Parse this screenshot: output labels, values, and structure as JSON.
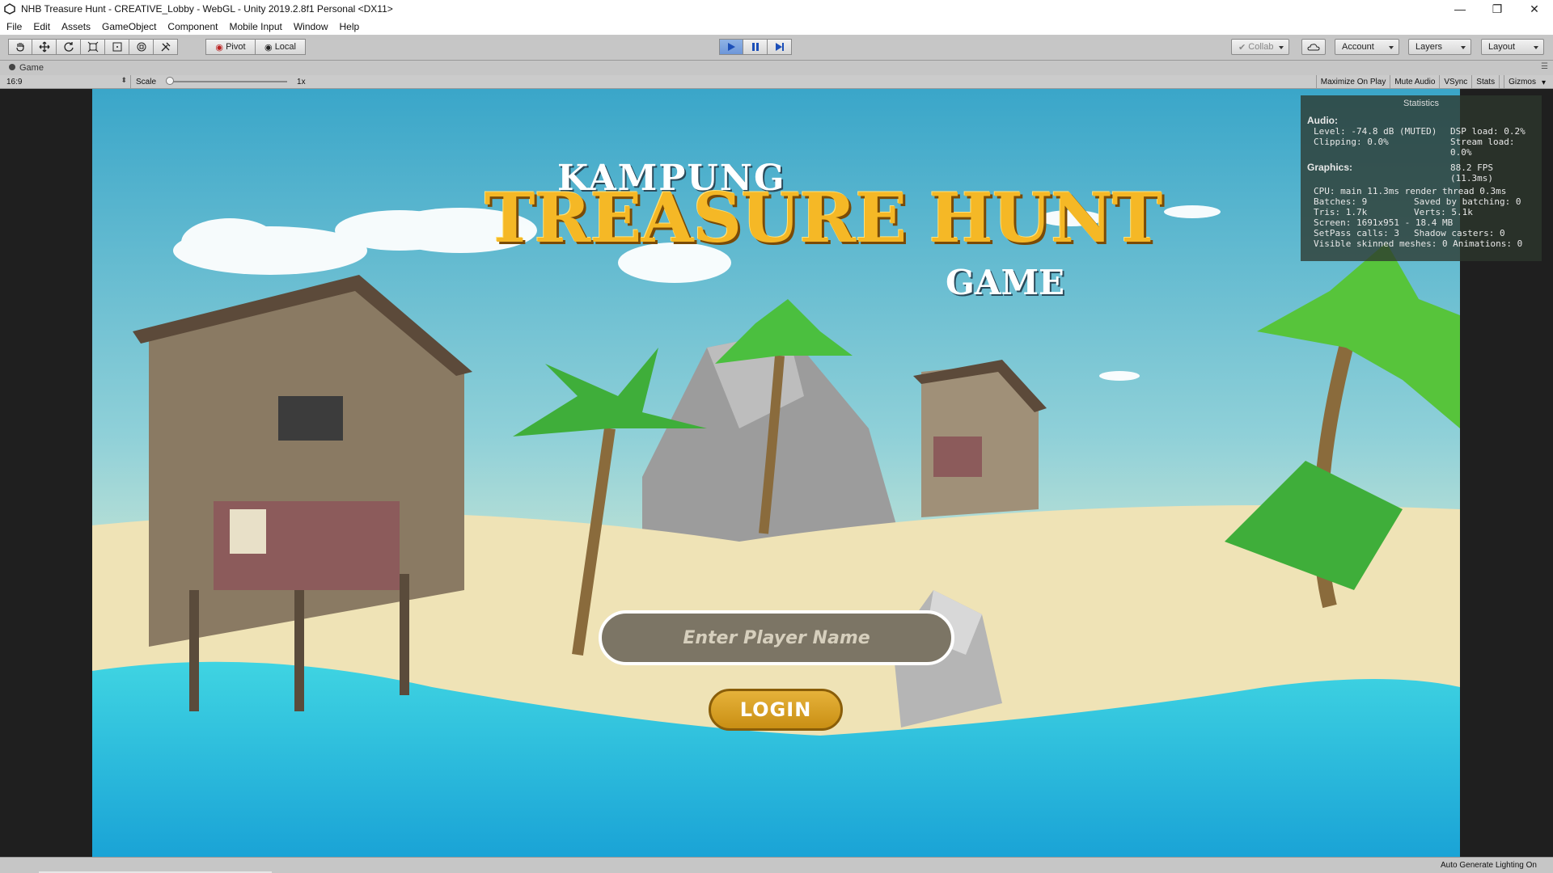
{
  "window": {
    "title": "NHB Treasure Hunt - CREATIVE_Lobby - WebGL - Unity 2019.2.8f1 Personal <DX11>",
    "controls": {
      "minimize": "—",
      "restore": "❐",
      "close": "✕"
    }
  },
  "menu": [
    "File",
    "Edit",
    "Assets",
    "GameObject",
    "Component",
    "Mobile Input",
    "Window",
    "Help"
  ],
  "toolbar": {
    "tools": [
      "hand-tool",
      "move-tool",
      "rotate-tool",
      "scale-tool",
      "rect-tool",
      "transform-tool",
      "custom-tool"
    ],
    "pivot_label": "Pivot",
    "local_label": "Local",
    "play_states": [
      "play",
      "pause",
      "step"
    ],
    "collab_label": "Collab",
    "account_label": "Account",
    "layers_label": "Layers",
    "layout_label": "Layout"
  },
  "game_tab": {
    "label": "Game"
  },
  "game_bar": {
    "aspect": "16:9",
    "scale_label": "Scale",
    "scale_value": "1x",
    "buttons": [
      "Maximize On Play",
      "Mute Audio",
      "VSync",
      "Stats",
      "Gizmos"
    ]
  },
  "scene": {
    "logo_top": "KAMPUNG",
    "logo_main": "TREASURE HUNT",
    "logo_bottom": "GAME",
    "input_placeholder": "Enter Player Name",
    "login_label": "LOGIN"
  },
  "stats": {
    "title": "Statistics",
    "audio_title": "Audio:",
    "level": "Level: -74.8 dB (MUTED)",
    "dsp_load": "DSP load: 0.2%",
    "clipping": "Clipping: 0.0%",
    "stream_load": "Stream load: 0.0%",
    "graphics_title": "Graphics:",
    "fps": "88.2 FPS (11.3ms)",
    "cpu": "CPU: main 11.3ms  render thread 0.3ms",
    "batches": "Batches: 9",
    "saved_batching": "Saved by batching: 0",
    "tris": "Tris: 1.7k",
    "verts": "Verts: 5.1k",
    "screen": "Screen: 1691x951 - 18.4 MB",
    "setpass": "SetPass calls: 3",
    "shadow_casters": "Shadow casters: 0",
    "skinned": "Visible skinned meshes: 0  Animations: 0"
  },
  "status": {
    "text": "Auto Generate Lighting On"
  }
}
